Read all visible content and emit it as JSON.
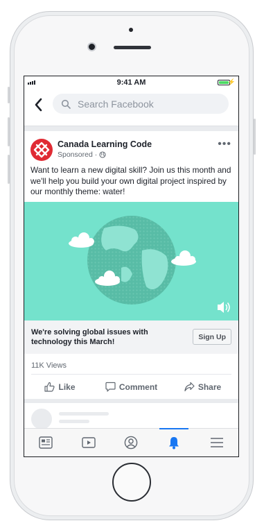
{
  "status_bar": {
    "time": "9:41 AM"
  },
  "nav": {
    "search_placeholder": "Search Facebook"
  },
  "post": {
    "page_name": "Canada Learning Code",
    "sponsored_label": "Sponsored",
    "separator": "·",
    "text": "Want to learn a new digital skill? Join us this month and we'll help you build your own digital project inspired by our monthly theme: water!",
    "cta_text": "We're solving global issues with technology this March!",
    "cta_button": "Sign Up",
    "views": "11K Views",
    "actions": {
      "like": "Like",
      "comment": "Comment",
      "share": "Share"
    }
  },
  "tabs": [
    {
      "icon": "news-feed-icon",
      "active": false
    },
    {
      "icon": "watch-icon",
      "active": false
    },
    {
      "icon": "profile-icon",
      "active": false
    },
    {
      "icon": "notifications-bell-icon",
      "active": true
    },
    {
      "icon": "menu-icon",
      "active": false
    }
  ],
  "colors": {
    "brand_blue": "#1877f2",
    "logo_red": "#e02b34",
    "media_background": "#74e2cc",
    "battery_green": "#4cd964"
  }
}
